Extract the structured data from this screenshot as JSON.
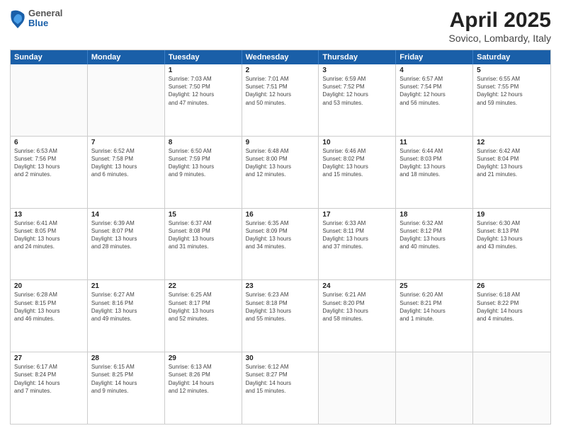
{
  "header": {
    "logo": {
      "general": "General",
      "blue": "Blue"
    },
    "title": "April 2025",
    "subtitle": "Sovico, Lombardy, Italy"
  },
  "calendar": {
    "days_of_week": [
      "Sunday",
      "Monday",
      "Tuesday",
      "Wednesday",
      "Thursday",
      "Friday",
      "Saturday"
    ],
    "rows": [
      [
        {
          "day": "",
          "info": ""
        },
        {
          "day": "",
          "info": ""
        },
        {
          "day": "1",
          "info": "Sunrise: 7:03 AM\nSunset: 7:50 PM\nDaylight: 12 hours\nand 47 minutes."
        },
        {
          "day": "2",
          "info": "Sunrise: 7:01 AM\nSunset: 7:51 PM\nDaylight: 12 hours\nand 50 minutes."
        },
        {
          "day": "3",
          "info": "Sunrise: 6:59 AM\nSunset: 7:52 PM\nDaylight: 12 hours\nand 53 minutes."
        },
        {
          "day": "4",
          "info": "Sunrise: 6:57 AM\nSunset: 7:54 PM\nDaylight: 12 hours\nand 56 minutes."
        },
        {
          "day": "5",
          "info": "Sunrise: 6:55 AM\nSunset: 7:55 PM\nDaylight: 12 hours\nand 59 minutes."
        }
      ],
      [
        {
          "day": "6",
          "info": "Sunrise: 6:53 AM\nSunset: 7:56 PM\nDaylight: 13 hours\nand 2 minutes."
        },
        {
          "day": "7",
          "info": "Sunrise: 6:52 AM\nSunset: 7:58 PM\nDaylight: 13 hours\nand 6 minutes."
        },
        {
          "day": "8",
          "info": "Sunrise: 6:50 AM\nSunset: 7:59 PM\nDaylight: 13 hours\nand 9 minutes."
        },
        {
          "day": "9",
          "info": "Sunrise: 6:48 AM\nSunset: 8:00 PM\nDaylight: 13 hours\nand 12 minutes."
        },
        {
          "day": "10",
          "info": "Sunrise: 6:46 AM\nSunset: 8:02 PM\nDaylight: 13 hours\nand 15 minutes."
        },
        {
          "day": "11",
          "info": "Sunrise: 6:44 AM\nSunset: 8:03 PM\nDaylight: 13 hours\nand 18 minutes."
        },
        {
          "day": "12",
          "info": "Sunrise: 6:42 AM\nSunset: 8:04 PM\nDaylight: 13 hours\nand 21 minutes."
        }
      ],
      [
        {
          "day": "13",
          "info": "Sunrise: 6:41 AM\nSunset: 8:05 PM\nDaylight: 13 hours\nand 24 minutes."
        },
        {
          "day": "14",
          "info": "Sunrise: 6:39 AM\nSunset: 8:07 PM\nDaylight: 13 hours\nand 28 minutes."
        },
        {
          "day": "15",
          "info": "Sunrise: 6:37 AM\nSunset: 8:08 PM\nDaylight: 13 hours\nand 31 minutes."
        },
        {
          "day": "16",
          "info": "Sunrise: 6:35 AM\nSunset: 8:09 PM\nDaylight: 13 hours\nand 34 minutes."
        },
        {
          "day": "17",
          "info": "Sunrise: 6:33 AM\nSunset: 8:11 PM\nDaylight: 13 hours\nand 37 minutes."
        },
        {
          "day": "18",
          "info": "Sunrise: 6:32 AM\nSunset: 8:12 PM\nDaylight: 13 hours\nand 40 minutes."
        },
        {
          "day": "19",
          "info": "Sunrise: 6:30 AM\nSunset: 8:13 PM\nDaylight: 13 hours\nand 43 minutes."
        }
      ],
      [
        {
          "day": "20",
          "info": "Sunrise: 6:28 AM\nSunset: 8:15 PM\nDaylight: 13 hours\nand 46 minutes."
        },
        {
          "day": "21",
          "info": "Sunrise: 6:27 AM\nSunset: 8:16 PM\nDaylight: 13 hours\nand 49 minutes."
        },
        {
          "day": "22",
          "info": "Sunrise: 6:25 AM\nSunset: 8:17 PM\nDaylight: 13 hours\nand 52 minutes."
        },
        {
          "day": "23",
          "info": "Sunrise: 6:23 AM\nSunset: 8:18 PM\nDaylight: 13 hours\nand 55 minutes."
        },
        {
          "day": "24",
          "info": "Sunrise: 6:21 AM\nSunset: 8:20 PM\nDaylight: 13 hours\nand 58 minutes."
        },
        {
          "day": "25",
          "info": "Sunrise: 6:20 AM\nSunset: 8:21 PM\nDaylight: 14 hours\nand 1 minute."
        },
        {
          "day": "26",
          "info": "Sunrise: 6:18 AM\nSunset: 8:22 PM\nDaylight: 14 hours\nand 4 minutes."
        }
      ],
      [
        {
          "day": "27",
          "info": "Sunrise: 6:17 AM\nSunset: 8:24 PM\nDaylight: 14 hours\nand 7 minutes."
        },
        {
          "day": "28",
          "info": "Sunrise: 6:15 AM\nSunset: 8:25 PM\nDaylight: 14 hours\nand 9 minutes."
        },
        {
          "day": "29",
          "info": "Sunrise: 6:13 AM\nSunset: 8:26 PM\nDaylight: 14 hours\nand 12 minutes."
        },
        {
          "day": "30",
          "info": "Sunrise: 6:12 AM\nSunset: 8:27 PM\nDaylight: 14 hours\nand 15 minutes."
        },
        {
          "day": "",
          "info": ""
        },
        {
          "day": "",
          "info": ""
        },
        {
          "day": "",
          "info": ""
        }
      ]
    ]
  }
}
